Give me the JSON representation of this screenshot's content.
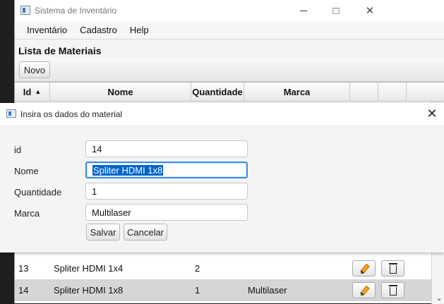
{
  "main": {
    "title": "Sistema de Inventário",
    "menu": [
      "Inventário",
      "Cadastro",
      "Help"
    ],
    "section_title": "Lista de Materiais",
    "new_button": "Novo",
    "columns": [
      "Id",
      "Nome",
      "Quantidade",
      "Marca"
    ],
    "rows": [
      {
        "id": "13",
        "name": "Spliter HDMI 1x4",
        "qty": "2",
        "brand": ""
      },
      {
        "id": "14",
        "name": "Spliter HDMI 1x8",
        "qty": "1",
        "brand": "Multilaser"
      }
    ]
  },
  "dialog": {
    "title": "Insira os dados do material",
    "labels": [
      "id",
      "Nome",
      "Quantidade",
      "Marca"
    ],
    "values": {
      "id": "14",
      "name": "Spliter HDMI 1x8",
      "qty": "1",
      "brand": "Multilaser"
    },
    "save": "Salvar",
    "cancel": "Cancelar"
  },
  "icons": {
    "window_minimize": "minimize-icon",
    "window_maximize": "maximize-icon",
    "window_close": "close-icon",
    "edit": "pencil-icon",
    "delete": "trash-icon",
    "sort": "sort-up-icon",
    "scroll_down": "chevron-down-icon"
  },
  "colors": {
    "selection": "#0066cc",
    "focus_border": "#3d8de0",
    "selected_row": "#d6d6d6"
  }
}
